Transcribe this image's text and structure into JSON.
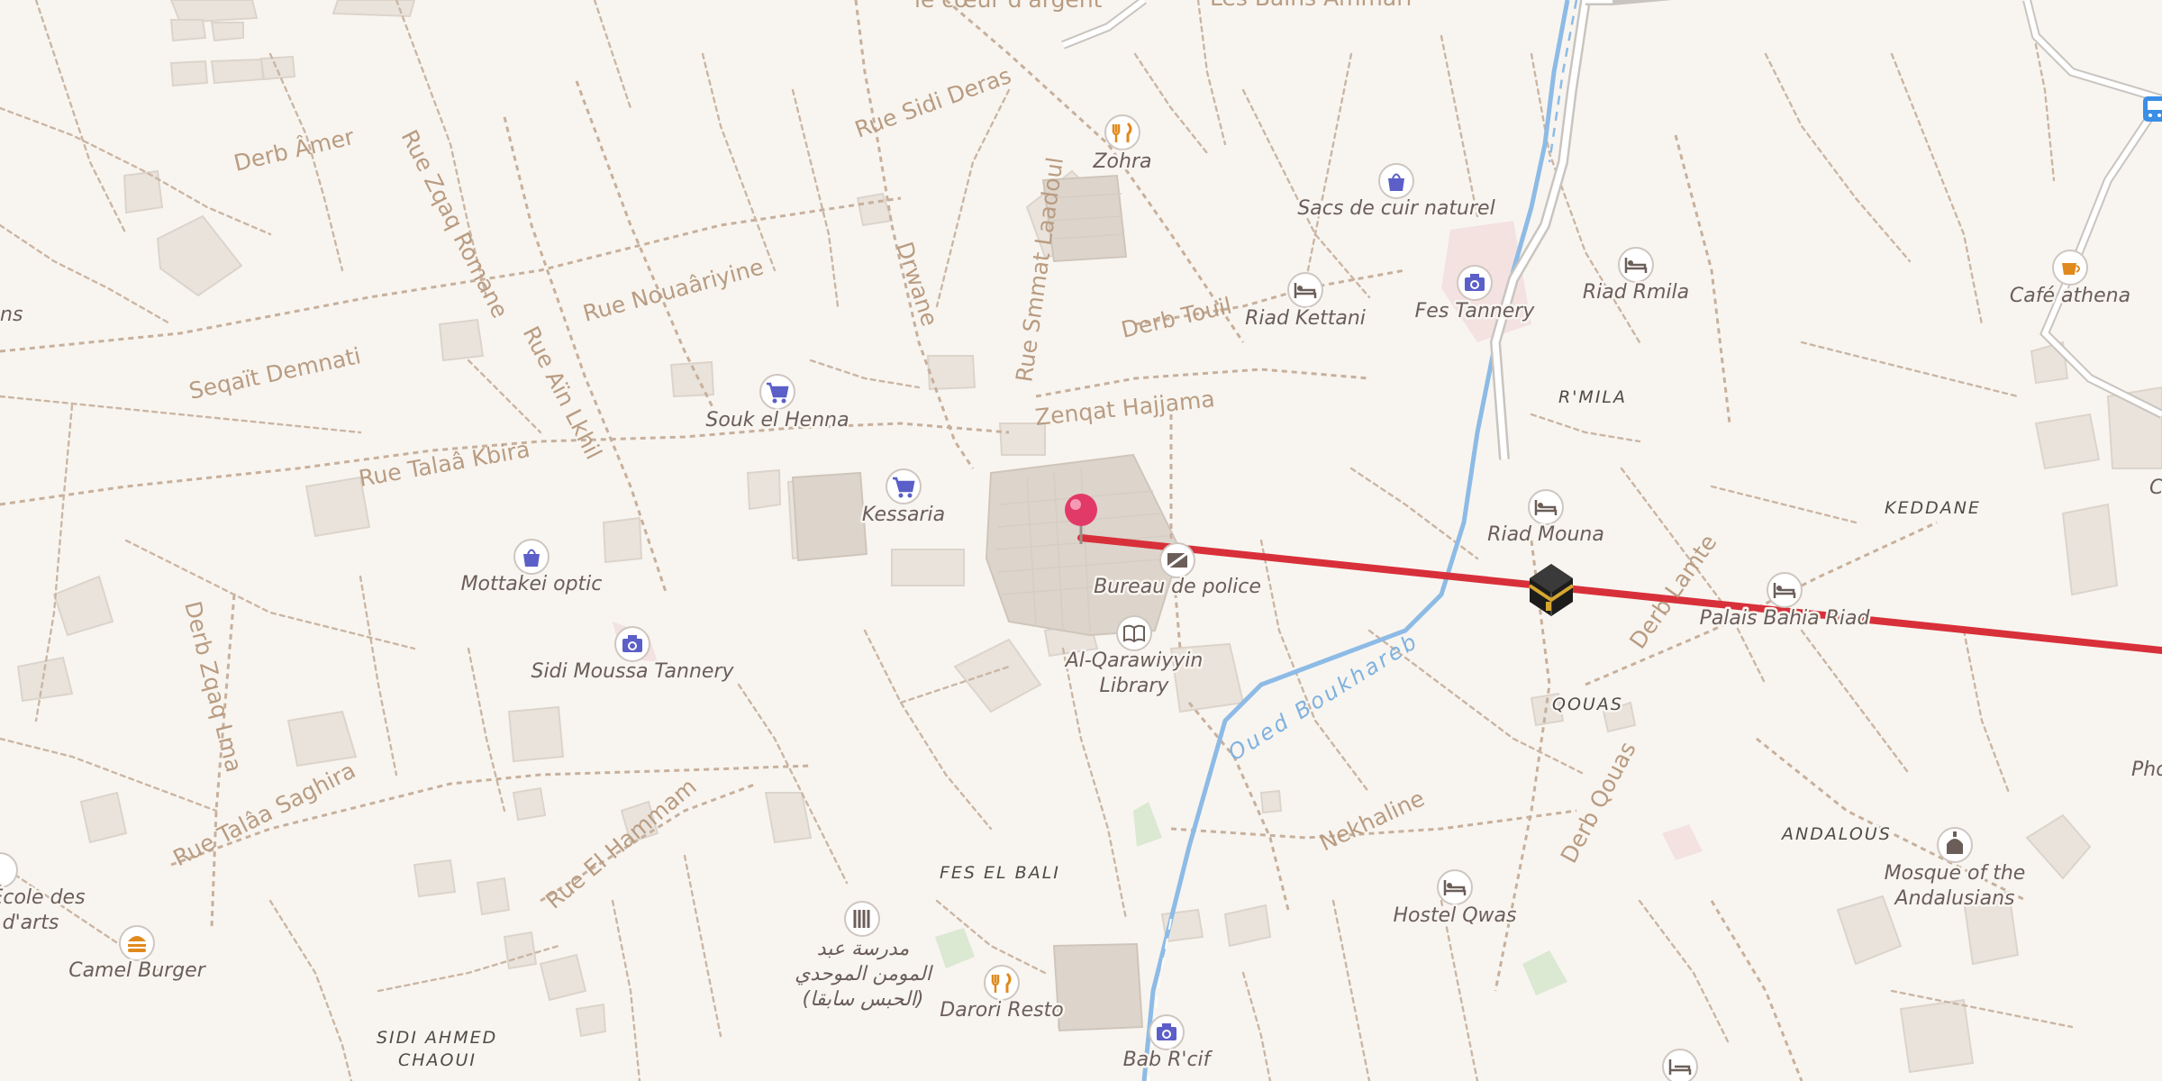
{
  "map": {
    "colors": {
      "background": "#f8f5f0",
      "route": "#d8303a",
      "water": "#8dbbe6",
      "pin": "#e23a68",
      "icon_shop": "#5b5fc7",
      "icon_food": "#e08a1e",
      "icon_generic": "#6b5e58"
    },
    "streets": [
      {
        "id": "derb-amer",
        "text": "Derb Âmer"
      },
      {
        "id": "rue-zqaq-romane",
        "text": "Rue Zqaq Romane"
      },
      {
        "id": "rue-sidi-deras",
        "text": "Rue Sidi Deras"
      },
      {
        "id": "rue-nouaariyine",
        "text": "Rue Nouaâriyine"
      },
      {
        "id": "rue-ain-lkhil",
        "text": "Rue Aïn Lkhil"
      },
      {
        "id": "seqait-demnati",
        "text": "Seqaït Demnati"
      },
      {
        "id": "rue-talaa-kbira",
        "text": "Rue Talaâ Kbira"
      },
      {
        "id": "derb-zqaq-lma",
        "text": "Derb Zqaq Lma"
      },
      {
        "id": "rue-talaa-saghira",
        "text": "Rue Talâa Saghira"
      },
      {
        "id": "rue-el-hammam",
        "text": "Rue El Hammam"
      },
      {
        "id": "derwane",
        "text": "Drwane"
      },
      {
        "id": "rue-smmat-laadoul",
        "text": "Rue Smmat Laadoul"
      },
      {
        "id": "derb-touil",
        "text": "Derb Touil"
      },
      {
        "id": "zenqat-hajjama",
        "text": "Zenqat Hajjama"
      },
      {
        "id": "nekhaline",
        "text": "Nekhaline"
      },
      {
        "id": "derb-qouas",
        "text": "Derb Qouas"
      },
      {
        "id": "derb-lamte",
        "text": "Derb Lamte"
      },
      {
        "id": "le-coeur",
        "text": "le cœur d'argent"
      },
      {
        "id": "les-bains",
        "text": "Les Bains Ammari"
      }
    ],
    "water_label": "Oued Boukhareb",
    "districts": [
      {
        "id": "rmila",
        "text": "R'MILA"
      },
      {
        "id": "keddane",
        "text": "KEDDANE"
      },
      {
        "id": "qouas",
        "text": "QOUAS"
      },
      {
        "id": "andalous",
        "text": "ANDALOUS"
      },
      {
        "id": "fes-el-bali",
        "text": "FES EL BALI"
      },
      {
        "id": "sidi-ahmed-1",
        "text": "SIDI AHMED"
      },
      {
        "id": "sidi-ahmed-2",
        "text": "CHAOUI"
      }
    ],
    "pois": [
      {
        "id": "zohra",
        "name": "Zohra",
        "icon": "restaurant-icon"
      },
      {
        "id": "sacs",
        "name": "Sacs de cuir naturel",
        "icon": "shopping-bag-icon"
      },
      {
        "id": "riad-rmila",
        "name": "Riad Rmila",
        "icon": "bed-icon"
      },
      {
        "id": "cafe-athena",
        "name": "Café athena",
        "icon": "cafe-icon"
      },
      {
        "id": "riad-kettani",
        "name": "Riad Kettani",
        "icon": "bed-icon"
      },
      {
        "id": "fes-tannery",
        "name": "Fes Tannery",
        "icon": "camera-icon"
      },
      {
        "id": "souk-henna",
        "name": "Souk el Henna",
        "icon": "cart-icon"
      },
      {
        "id": "kessaria",
        "name": "Kessaria",
        "icon": "cart-icon"
      },
      {
        "id": "riad-mouna",
        "name": "Riad Mouna",
        "icon": "bed-icon"
      },
      {
        "id": "mottakei",
        "name": "Mottakei optic",
        "icon": "shopping-bag-icon"
      },
      {
        "id": "bureau-police",
        "name": "Bureau de police",
        "icon": "police-icon"
      },
      {
        "id": "palais-bahia",
        "name": "Palais Bahia Riad",
        "icon": "bed-icon"
      },
      {
        "id": "sidi-moussa",
        "name": "Sidi Moussa Tannery",
        "icon": "camera-icon"
      },
      {
        "id": "qarawiyyin-1",
        "name": "Al-Qarawiyyin",
        "icon": "book-icon"
      },
      {
        "id": "qarawiyyin-2",
        "name": "Library",
        "icon": ""
      },
      {
        "id": "mosque-andalus-1",
        "name": "Mosque of the",
        "icon": "mosque-icon"
      },
      {
        "id": "mosque-andalus-2",
        "name": "Andalusians",
        "icon": ""
      },
      {
        "id": "hostel-qwas",
        "name": "Hostel Qwas",
        "icon": "bed-icon"
      },
      {
        "id": "ecole-1",
        "name": "École des",
        "icon": ""
      },
      {
        "id": "ecole-2",
        "name": "d'arts",
        "icon": ""
      },
      {
        "id": "camel-burger",
        "name": "Camel Burger",
        "icon": "burger-icon"
      },
      {
        "id": "darori",
        "name": "Darori Resto",
        "icon": "restaurant-icon"
      },
      {
        "id": "bab-rcif",
        "name": "Bab R'cif",
        "icon": "camera-icon"
      },
      {
        "id": "medersa-1",
        "name": "مدرسة عبد",
        "icon": "school-icon"
      },
      {
        "id": "medersa-2",
        "name": "المومن الموحدي",
        "icon": ""
      },
      {
        "id": "medersa-3",
        "name": "(الحبس سابقا)",
        "icon": ""
      },
      {
        "id": "edge-ns",
        "name": "ns",
        "icon": ""
      },
      {
        "id": "edge-c",
        "name": "C",
        "icon": ""
      },
      {
        "id": "edge-pho",
        "name": "Pho",
        "icon": ""
      }
    ]
  }
}
